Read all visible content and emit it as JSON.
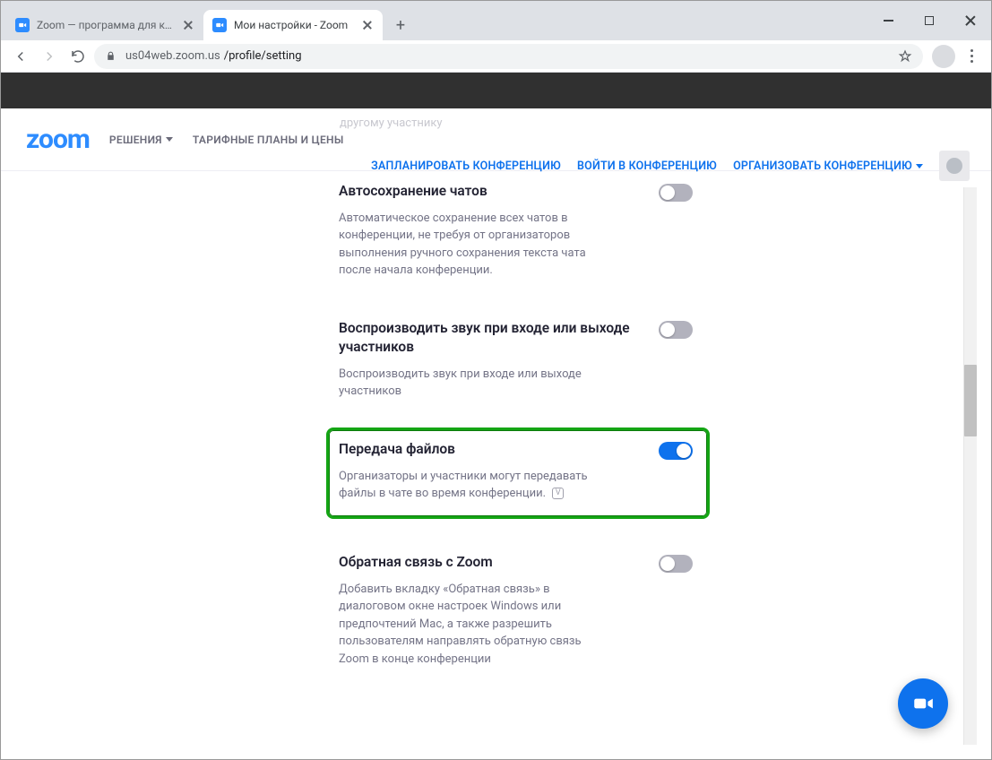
{
  "browser": {
    "tabs": [
      {
        "title": "Zoom — программа для конфе",
        "active": false
      },
      {
        "title": "Мои настройки - Zoom",
        "active": true
      }
    ],
    "url_host": "us04web.zoom.us",
    "url_path": "/profile/setting"
  },
  "header": {
    "logo": "zoom",
    "nav": {
      "solutions": "РЕШЕНИЯ",
      "plans": "ТАРИФНЫЕ ПЛАНЫ И ЦЕНЫ"
    },
    "actions": {
      "schedule": "ЗАПЛАНИРОВАТЬ КОНФЕРЕНЦИЮ",
      "join": "ВОЙТИ В КОНФЕРЕНЦИЮ",
      "host": "ОРГАНИЗОВАТЬ КОНФЕРЕНЦИЮ"
    }
  },
  "ghost": {
    "line": "другому участнику"
  },
  "settings": [
    {
      "key": "autosave",
      "title": "Автосохранение чатов",
      "desc": "Автоматическое сохранение всех чатов в конференции, не требуя от организаторов выполнения ручного сохранения текста чата после начала конференции.",
      "on": false
    },
    {
      "key": "play_sound",
      "title": "Воспроизводить звук при входе или выходе участников",
      "desc": "Воспроизводить звук при входе или выходе участников",
      "on": false
    },
    {
      "key": "file_transfer",
      "title": "Передача файлов",
      "desc": "Организаторы и участники могут передавать файлы в чате во время конференции.",
      "on": true,
      "highlighted": true,
      "info_icon": true
    },
    {
      "key": "feedback",
      "title": "Обратная связь с Zoom",
      "desc": "Добавить вкладку «Обратная связь» в диалоговом окне настроек Windows или предпочтений Mac, а также разрешить пользователям направлять обратную связь Zoom в конце конференции",
      "on": false
    }
  ]
}
